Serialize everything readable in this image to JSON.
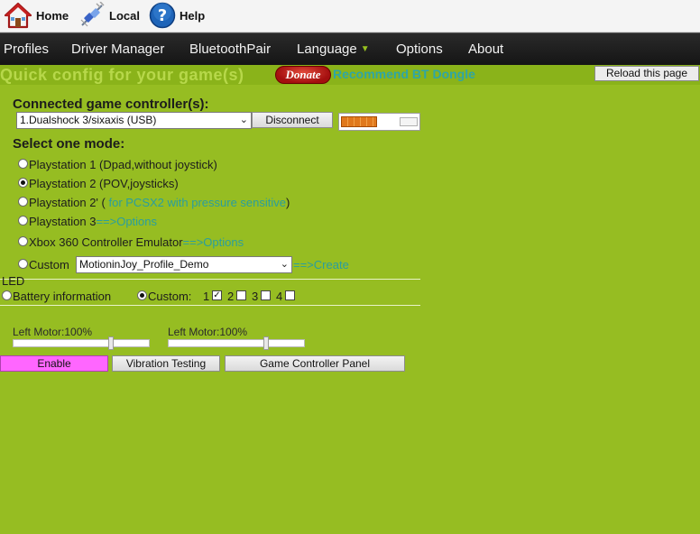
{
  "toolbar": {
    "home": "Home",
    "local": "Local",
    "help": "Help"
  },
  "nav": {
    "profiles": "Profiles",
    "driver_manager": "Driver Manager",
    "bluetooth_pair": "BluetoothPair",
    "language": "Language",
    "options": "Options",
    "about": "About"
  },
  "banner": {
    "quick_config": "Quick config for your game(s)",
    "donate": "Donate",
    "recommend": "Recommend BT Dongle",
    "reload": "Reload this page"
  },
  "controller": {
    "heading": "Connected game controller(s):",
    "selected": "1.Dualshock 3/sixaxis (USB)",
    "disconnect": "Disconnect",
    "battery_level": 0.72
  },
  "mode": {
    "heading": "Select one mode:",
    "ps1": "Playstation 1 (Dpad,without joystick)",
    "ps2": "Playstation 2 (POV,joysticks)",
    "ps2p_a": "Playstation 2' (",
    "ps2p_b": " for PCSX2 with pressure sensitive",
    "ps2p_c": ")",
    "ps3_a": "Playstation 3",
    "ps3_b": "==>Options",
    "xbox_a": "Xbox 360 Controller Emulator",
    "xbox_b": "==>Options",
    "custom_label": "Custom",
    "custom_profile": "MotioninJoy_Profile_Demo",
    "custom_create": "==>Create",
    "selected_mode": "ps2"
  },
  "led": {
    "heading": "LED",
    "battery_info": "Battery information",
    "custom": "Custom:",
    "n1": "1",
    "n2": "2",
    "n3": "3",
    "n4": "4"
  },
  "vibration": {
    "left_motor_1": "Left Motor:100%",
    "left_motor_2": "Left Motor:100%",
    "slider_1_value": 0.72,
    "slider_2_value": 0.72,
    "enable": "Enable",
    "testing": "Vibration Testing",
    "panel": "Game Controller Panel"
  },
  "colors": {
    "background": "#96bd22",
    "navbar": "#1e1e1e",
    "accent_teal": "#2a9e9e",
    "enable_pink": "#ff66ff",
    "donate_red": "#c41f1f"
  }
}
